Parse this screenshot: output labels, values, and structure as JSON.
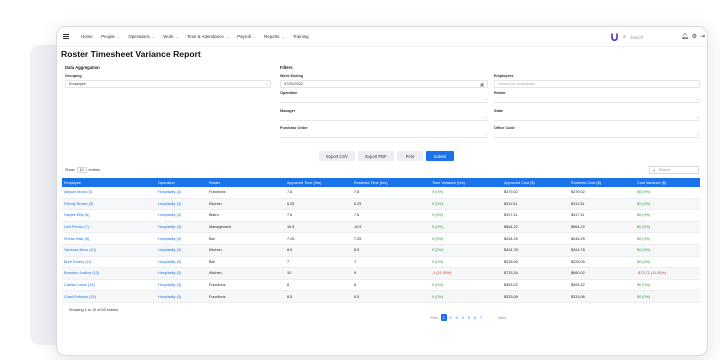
{
  "header": {
    "nav": [
      {
        "label": "Home",
        "chevron": false
      },
      {
        "label": "People",
        "chevron": true
      },
      {
        "label": "Operations",
        "chevron": true
      },
      {
        "label": "Work",
        "chevron": true
      },
      {
        "label": "Time & Attendance",
        "chevron": true
      },
      {
        "label": "Payroll",
        "chevron": true
      },
      {
        "label": "Reports",
        "chevron": true
      },
      {
        "label": "Training",
        "chevron": false
      }
    ],
    "search_placeholder": "Search"
  },
  "page_title": "Roster Timesheet Variance Report",
  "aggregation": {
    "section_label": "Data Aggregation",
    "grouping_label": "Grouping",
    "grouping_value": "Employee"
  },
  "filters": {
    "section_label": "Filters",
    "week_ending_label": "Week Ending",
    "week_ending_value": "07/25/2022",
    "operation_label": "Operation",
    "manager_label": "Manager",
    "purchase_order_label": "Purchase Order",
    "employees_label": "Employees",
    "employees_placeholder": "Search for employees",
    "roster_label": "Roster",
    "state_label": "State",
    "office_code_label": "Office Code"
  },
  "buttons": {
    "export_csv": "Export CSV",
    "export_pdf": "Export PDF",
    "print": "Print",
    "submit": "Submit"
  },
  "table": {
    "show_label": "Show",
    "show_value": "10",
    "entries_label": "entries",
    "search_placeholder": "Search",
    "columns": [
      "Employee",
      "Operation",
      "Roster",
      "Approved Time (hrs)",
      "Rostered Time (hrs)",
      "Time Variance (hrs)",
      "Approved Cost ($)",
      "Rostered Cost ($)",
      "Cost Variance ($)"
    ],
    "rows": [
      {
        "employee": "Allyson Moss (3)",
        "operation": "Hospitality (3)",
        "roster": "Functions",
        "approved_time": "7.8",
        "rostered_time": "7.8",
        "time_variance": "0 (0%)",
        "approved_cost": "$379.02",
        "rostered_cost": "$379.02",
        "cost_variance": "$0 (0%)",
        "negative": false
      },
      {
        "employee": "Felicity Brown (5)",
        "operation": "Hospitality (3)",
        "roster": "Kitchen",
        "approved_time": "6.25",
        "rostered_time": "6.25",
        "time_variance": "0 (0%)",
        "approved_cost": "$311.51",
        "rostered_cost": "$311.51",
        "cost_variance": "$0 (0%)",
        "negative": false
      },
      {
        "employee": "Haylee Ellis (6)",
        "operation": "Hospitality (3)",
        "roster": "Bistro",
        "approved_time": "7.6",
        "rostered_time": "7.6",
        "time_variance": "0 (0%)",
        "approved_cost": "$317.11",
        "rostered_cost": "$317.11",
        "cost_variance": "$0 (0%)",
        "negative": false
      },
      {
        "employee": "Lexi Perrez (7)",
        "operation": "Hospitality (3)",
        "roster": "Management",
        "approved_time": "10.5",
        "rostered_time": "10.5",
        "time_variance": "0 (0%)",
        "approved_cost": "$564.22",
        "rostered_cost": "$564.22",
        "cost_variance": "$0 (0%)",
        "negative": false
      },
      {
        "employee": "Sheila Hale (8)",
        "operation": "Hospitality (3)",
        "roster": "Bar",
        "approved_time": "7.25",
        "rostered_time": "7.25",
        "time_variance": "0 (0%)",
        "approved_cost": "$244.25",
        "rostered_cost": "$244.25",
        "cost_variance": "$0 (0%)",
        "negative": false
      },
      {
        "employee": "Vanessa Benz (10)",
        "operation": "Hospitality (3)",
        "roster": "Kitchen",
        "approved_time": "8.5",
        "rostered_time": "8.5",
        "time_variance": "0 (0%)",
        "approved_cost": "$424.78",
        "rostered_cost": "$424.78",
        "cost_variance": "$0 (0%)",
        "negative": false
      },
      {
        "employee": "Bree Emery (11)",
        "operation": "Hospitality (3)",
        "roster": "Bar",
        "approved_time": "7",
        "rostered_time": "7",
        "time_variance": "0 (0%)",
        "approved_cost": "$228.05",
        "rostered_cost": "$228.05",
        "cost_variance": "$0 (0%)",
        "negative": false
      },
      {
        "employee": "Brandon Justice (13)",
        "operation": "Hospitality (3)",
        "roster": "Kitchen",
        "approved_time": "10",
        "rostered_time": "9",
        "time_variance": "-1 (11.00%)",
        "approved_cost": "$733.34",
        "rostered_cost": "$660.02",
        "cost_variance": "-$73.72 (11.00%)",
        "negative": true
      },
      {
        "employee": "Caelan Lewis (14)",
        "operation": "Hospitality (3)",
        "roster": "Functions",
        "approved_time": "8",
        "rostered_time": "8",
        "time_variance": "0 (0%)",
        "approved_cost": "$393.22",
        "rostered_cost": "$393.22",
        "cost_variance": "$0 (0%)",
        "negative": false
      },
      {
        "employee": "Chad Robison (15)",
        "operation": "Hospitality (3)",
        "roster": "Functions",
        "approved_time": "8.5",
        "rostered_time": "8.5",
        "time_variance": "0 (0%)",
        "approved_cost": "$333.06",
        "rostered_cost": "$333.06",
        "cost_variance": "$0 (0%)",
        "negative": false
      }
    ],
    "footer": "Showing 1 to 10 of 63 entries"
  },
  "pagination": {
    "prev": "Prev",
    "pages": [
      "1",
      "2",
      "3",
      "4",
      "5",
      "6",
      "7"
    ],
    "active": "1",
    "next": "Next"
  },
  "colors": {
    "accent": "#1a73e8",
    "positive": "#2e9b36",
    "negative": "#d93025"
  }
}
